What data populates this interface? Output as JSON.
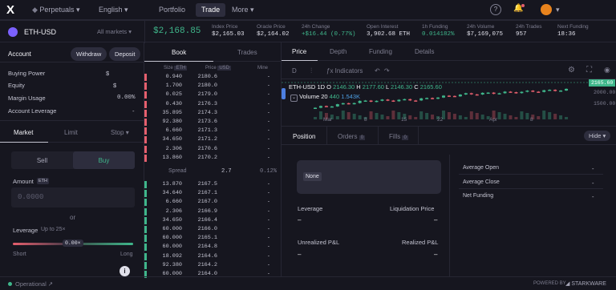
{
  "nav": {
    "logo": "X",
    "network": "Perpetuals",
    "language": "English",
    "items": [
      "Portfolio",
      "Trade",
      "More"
    ],
    "avatar_color": "#e55f6d"
  },
  "market": {
    "symbol": "ETH-USD",
    "markets_label": "All markets",
    "price": "$2,168.85",
    "stats": [
      {
        "label": "Index Price",
        "value": "$2,165.03"
      },
      {
        "label": "Oracle Price",
        "value": "$2,164.02"
      },
      {
        "label": "24h Change",
        "value": "+$16.44 (0.77%)"
      },
      {
        "label": "Open Interest",
        "value": "3,902.68 ETH"
      },
      {
        "label": "1h Funding",
        "value": "0.014182%"
      },
      {
        "label": "24h Volume",
        "value": "$7,169,075"
      },
      {
        "label": "24h Trades",
        "value": "957"
      },
      {
        "label": "Next Funding",
        "value": "18:36"
      }
    ]
  },
  "account": {
    "title": "Account",
    "withdraw": "Withdraw",
    "deposit": "Deposit",
    "rows": [
      {
        "label": "Buying Power",
        "value": "$"
      },
      {
        "label": "Equity",
        "value": "$"
      },
      {
        "label": "Margin Usage",
        "value": "0.00%"
      },
      {
        "label": "Account Leverage",
        "value": "-"
      }
    ]
  },
  "order_form": {
    "tabs": [
      "Market",
      "Limit",
      "Stop"
    ],
    "sell": "Sell",
    "buy": "Buy",
    "amount_label": "Amount",
    "amount_unit": "ETH",
    "amount_placeholder": "0.0000",
    "or": "or",
    "leverage_label": "Leverage",
    "leverage_hint": "Up to 25×",
    "leverage_value": "0.00×",
    "short": "Short",
    "long": "Long",
    "info": "i"
  },
  "book": {
    "tabs": [
      "Book",
      "Trades"
    ],
    "headers": [
      "Size",
      "ETH",
      "Price",
      "USD",
      "Mine"
    ],
    "asks": [
      [
        "0.940",
        "2180.6",
        "-"
      ],
      [
        "1.700",
        "2180.0",
        "-"
      ],
      [
        "0.025",
        "2179.0",
        "-"
      ],
      [
        "0.430",
        "2176.3",
        "-"
      ],
      [
        "35.895",
        "2174.3",
        "-"
      ],
      [
        "92.380",
        "2173.6",
        "-"
      ],
      [
        "6.660",
        "2171.3",
        "-"
      ],
      [
        "34.650",
        "2171.2",
        "-"
      ],
      [
        "2.306",
        "2170.6",
        "-"
      ],
      [
        "13.860",
        "2170.2",
        "-"
      ]
    ],
    "spread_label": "Spread",
    "spread_value": "2.7",
    "spread_pct": "0.12%",
    "bids": [
      [
        "13.870",
        "2167.5",
        "-"
      ],
      [
        "34.640",
        "2167.1",
        "-"
      ],
      [
        "6.660",
        "2167.0",
        "-"
      ],
      [
        "2.306",
        "2166.9",
        "-"
      ],
      [
        "34.650",
        "2166.4",
        "-"
      ],
      [
        "60.000",
        "2166.0",
        "-"
      ],
      [
        "60.000",
        "2165.1",
        "-"
      ],
      [
        "60.000",
        "2164.8",
        "-"
      ],
      [
        "18.092",
        "2164.6",
        "-"
      ],
      [
        "92.380",
        "2164.2",
        "-"
      ],
      [
        "60.000",
        "2164.0",
        "-"
      ]
    ]
  },
  "chart": {
    "tabs": [
      "Price",
      "Depth",
      "Funding",
      "Details"
    ],
    "toolbar": {
      "interval": "D",
      "indicators": "Indicators"
    },
    "legend": {
      "symbol": "ETH-USD",
      "interval": "1D",
      "o": "2146.30",
      "h": "2177.60",
      "l": "2146.30",
      "c": "2165.60"
    },
    "volume_label": "Volume 20",
    "volume_vals": [
      "440",
      "1.543K"
    ],
    "price_tag": "2165.60",
    "y_ticks": [
      "2000.00",
      "1500.00"
    ],
    "x_ticks": [
      "Mar",
      "8",
      "15",
      "22",
      "Apr",
      "8"
    ]
  },
  "chart_data": {
    "type": "line",
    "title": "ETH-USD",
    "x": [
      "Mar",
      "8",
      "15",
      "22",
      "Apr",
      "8"
    ],
    "series": [
      {
        "values": [
          1650,
          1820,
          1850,
          1990,
          2040,
          2100
        ]
      }
    ],
    "ylim": [
      1400,
      2200
    ]
  },
  "positions": {
    "tabs": [
      {
        "label": "Position"
      },
      {
        "label": "Orders",
        "count": "0"
      },
      {
        "label": "Fills",
        "count": "0"
      }
    ],
    "hide": "Hide",
    "market_name": "None",
    "fields": [
      {
        "label": "Leverage",
        "value": "–"
      },
      {
        "label": "Liquidation Price",
        "value": "–"
      },
      {
        "label": "Unrealized P&L",
        "value": "–"
      },
      {
        "label": "Realized P&L",
        "value": "–"
      }
    ],
    "side_stats": [
      {
        "label": "Average Open",
        "value": "-"
      },
      {
        "label": "Average Close",
        "value": "-"
      },
      {
        "label": "Net Funding",
        "value": "-"
      }
    ]
  },
  "footer": {
    "status": "Operational",
    "powered": "POWERED BY",
    "brand": "STARKWARE"
  }
}
